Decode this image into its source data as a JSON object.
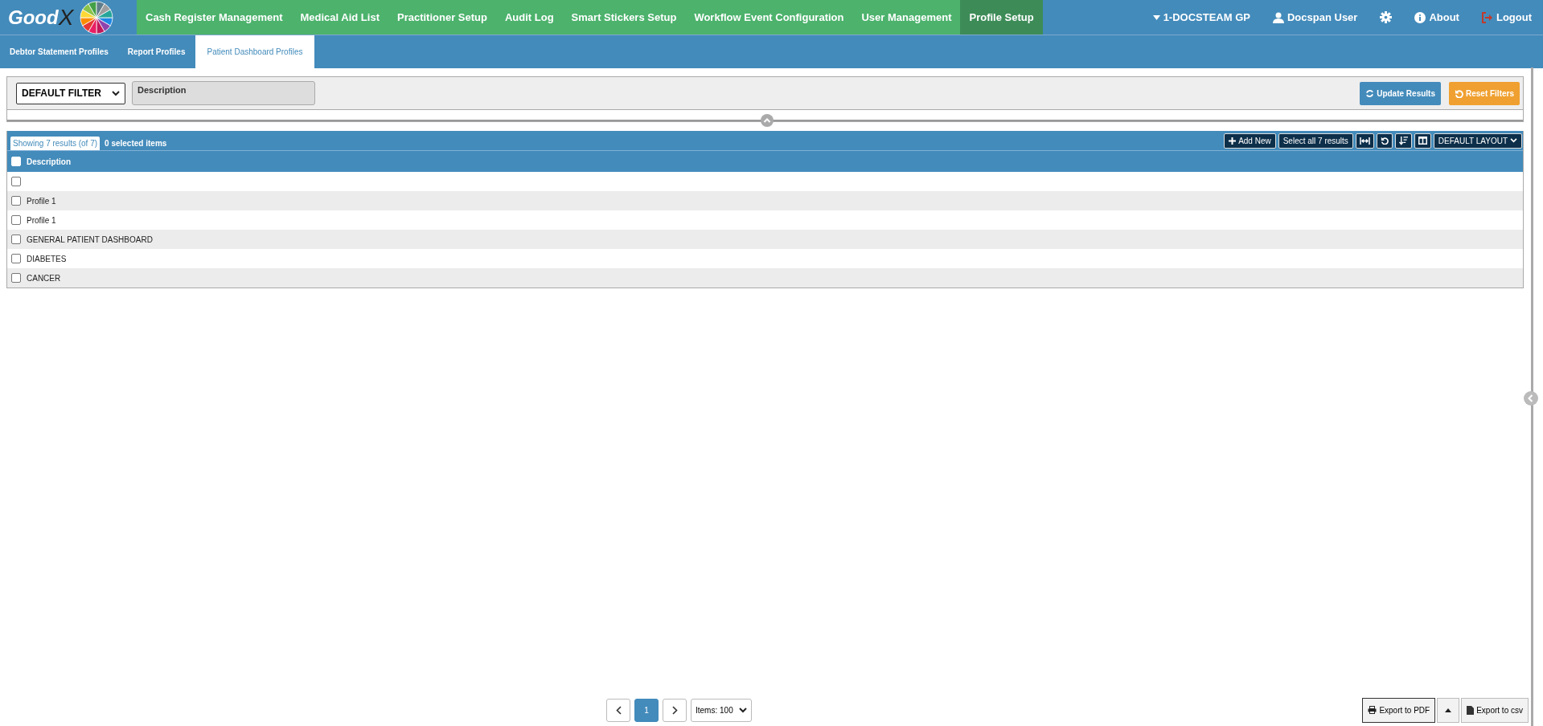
{
  "logo": {
    "text": "Good",
    "mark": "X"
  },
  "nav": [
    {
      "label": "Cash Register Management",
      "selected": false
    },
    {
      "label": "Medical Aid List",
      "selected": false
    },
    {
      "label": "Practitioner Setup",
      "selected": false
    },
    {
      "label": "Audit Log",
      "selected": false
    },
    {
      "label": "Smart Stickers Setup",
      "selected": false
    },
    {
      "label": "Workflow Event Configuration",
      "selected": false
    },
    {
      "label": "User Management",
      "selected": false
    },
    {
      "label": "Profile Setup",
      "selected": true
    }
  ],
  "user_menu": {
    "practice": "1-DOCSTEAM GP",
    "user": "Docspan User",
    "about": "About",
    "logout": "Logout"
  },
  "subtabs": [
    {
      "label": "Debtor Statement Profiles",
      "selected": false
    },
    {
      "label": "Report Profiles",
      "selected": false
    },
    {
      "label": "Patient Dashboard Profiles",
      "selected": true
    }
  ],
  "filter": {
    "select": "DEFAULT FILTER",
    "description": {
      "placeholder": "Description"
    },
    "update_button": "Update Results",
    "reset_button": "Reset Filters"
  },
  "table": {
    "tabs": [
      {
        "label": "Showing 7 results (of 7)",
        "selected": true
      },
      {
        "label": "0 selected items",
        "selected": false
      }
    ],
    "add_button": "Add New",
    "select_all_button": "Select all 7 results",
    "layout_button": "DEFAULT LAYOUT",
    "header_checked": false,
    "columns": [
      "Description"
    ],
    "rows": [
      {
        "description": "",
        "checked": false
      },
      {
        "description": "Profile 1",
        "checked": false
      },
      {
        "description": "Profile 1",
        "checked": false
      },
      {
        "description": "GENERAL PATIENT DASHBOARD",
        "checked": false
      },
      {
        "description": "DIABETES",
        "checked": false
      },
      {
        "description": "CANCER",
        "checked": false
      }
    ]
  },
  "pagination": {
    "pages": [
      {
        "label": "1",
        "selected": true
      }
    ],
    "items": "Items: 100"
  },
  "export": {
    "pdf": "Export to PDF",
    "csv": "Export to csv"
  }
}
